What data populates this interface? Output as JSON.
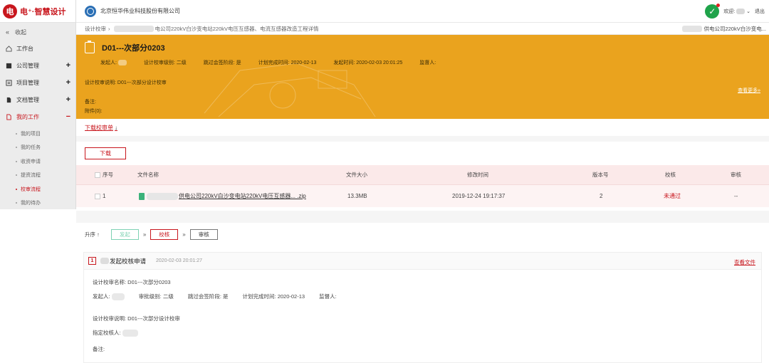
{
  "brand": {
    "mark": "电",
    "name": "电⁺·智慧设计"
  },
  "company": {
    "name": "北京恒华伟业科技股份有限公司"
  },
  "top": {
    "welcome": "欢迎:",
    "logout": "退出"
  },
  "sidebar": {
    "collapse": "收起",
    "items": [
      {
        "label": "工作台",
        "icon": "home-icon",
        "plus": ""
      },
      {
        "label": "公司管理",
        "icon": "company-icon",
        "plus": "+"
      },
      {
        "label": "项目管理",
        "icon": "project-icon",
        "plus": "+"
      },
      {
        "label": "文档管理",
        "icon": "document-icon",
        "plus": "+"
      },
      {
        "label": "我的工作",
        "icon": "work-icon",
        "plus": "−"
      }
    ],
    "subitems": [
      "我的项目",
      "我的任务",
      "收资申请",
      "提资流程",
      "校审流程",
      "我的待办"
    ]
  },
  "breadcrumb": {
    "root": "设计校审",
    "sep": "›",
    "path": "电公司220kV白沙变电站220kV电压互感器、电流互感器改造工程详情",
    "right": "供电公司220kV白沙变电..."
  },
  "banner": {
    "title": "D01---次部分0203",
    "initiator_label": "发起人:",
    "level": "设计校审级别: 二级",
    "skip": "跳过会签阶段: 是",
    "plan_time": "计划完成时间: 2020-02-13",
    "start_time": "发起时间: 2020-02-03 20:01:25",
    "supervisor": "监督人:",
    "desc": "设计校审说明: D01---次部分设计校审",
    "more": "查看更多»",
    "note": "备注:",
    "attach": "附件(0):"
  },
  "download_list": {
    "label": "下载校审单",
    "arrow": "↓"
  },
  "files": {
    "download_button": "下载",
    "headers": [
      "序号",
      "文件名称",
      "文件大小",
      "修改时间",
      "版本号",
      "校核",
      "审核"
    ],
    "rows": [
      {
        "index": "1",
        "name": "供电公司220kV白沙变电站220kV电压互感器... .zip",
        "size": "13.3MB",
        "modified": "2019-12-24 19:17:37",
        "version": "2",
        "check": "未通过",
        "audit": "--"
      }
    ]
  },
  "flow": {
    "order_label": "升序",
    "order_arrow": "↑",
    "steps": [
      {
        "label": "发起",
        "state": "done"
      },
      {
        "label": "校核",
        "state": "current"
      },
      {
        "label": "审核",
        "state": "todo"
      }
    ],
    "sep": "»"
  },
  "review": {
    "number": "1",
    "title": "发起校核申请",
    "time": "2020-02-03 20:01:27",
    "view_file": "查看文件",
    "name_line": "设计校审名称:  D01---次部分0203",
    "initiator": "发起人:",
    "approval_level": "审批级别: 二级",
    "skip": "跳过会签阶段: 是",
    "plan_time": "计划完成时间: 2020-02-13",
    "supervisor": "监督人:",
    "desc": "设计校审说明: D01---次部分设计校审",
    "assigned": "指定校核人:",
    "note": "备注:"
  },
  "colors": {
    "accent": "#c8161d",
    "banner": "#eaa31e",
    "ok": "#1fa34a"
  }
}
